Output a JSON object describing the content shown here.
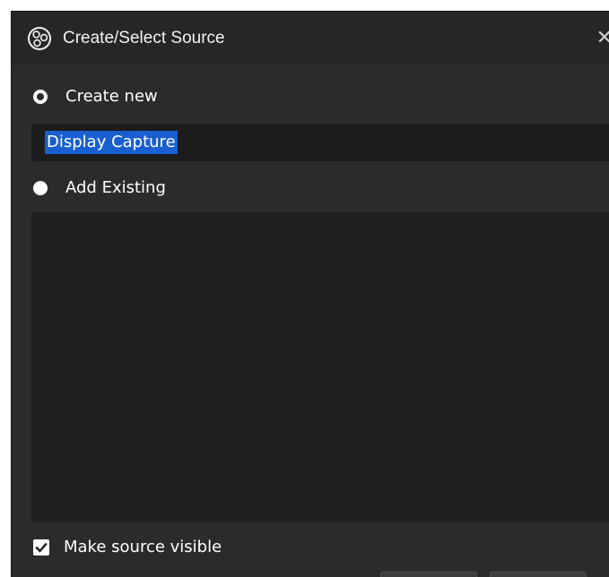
{
  "window": {
    "title": "Create/Select Source",
    "close_glyph": "✕",
    "icon": "obs-logo-icon"
  },
  "create_new": {
    "label": "Create new",
    "selected": true,
    "name_value": "Display Capture"
  },
  "add_existing": {
    "label": "Add Existing",
    "selected": false,
    "items": []
  },
  "make_visible": {
    "label": "Make source visible",
    "checked": true
  },
  "colors": {
    "window_bg": "#2b2b2b",
    "titlebar_bg": "#262626",
    "field_bg": "#1c1c1c",
    "selection": "#1a5fd0",
    "list_bg": "#1e1e1e"
  }
}
